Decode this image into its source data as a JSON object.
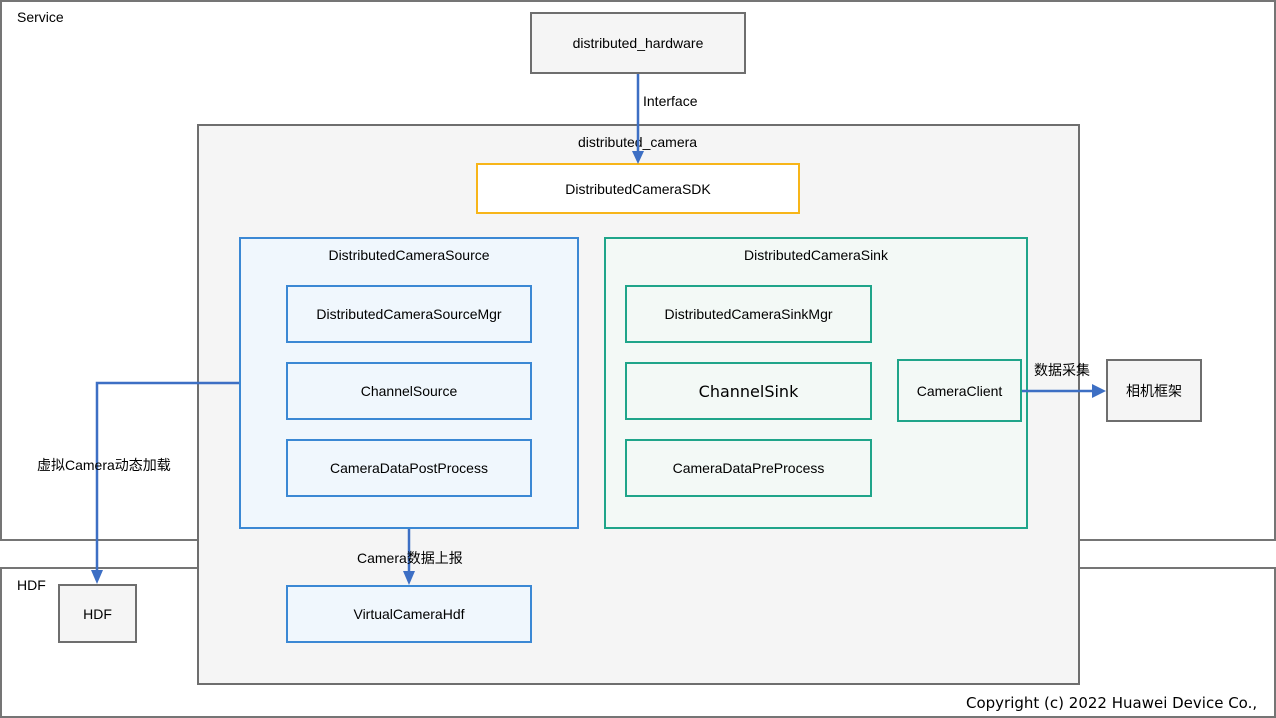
{
  "zones": {
    "service": {
      "label": "Service"
    },
    "hdf": {
      "label": "HDF"
    }
  },
  "nodes": {
    "distributed_hardware": "distributed_hardware",
    "distributed_camera": "distributed_camera",
    "sdk": "DistributedCameraSDK",
    "source": {
      "title": "DistributedCameraSource",
      "items": [
        "DistributedCameraSourceMgr",
        "ChannelSource",
        "CameraDataPostProcess"
      ]
    },
    "sink": {
      "title": "DistributedCameraSink",
      "items": [
        "DistributedCameraSinkMgr",
        "ChannelSink",
        "CameraDataPreProcess"
      ],
      "client": "CameraClient"
    },
    "camera_framework": "相机框架",
    "hdf": "HDF",
    "virtual_camera_hdf": "VirtualCameraHdf"
  },
  "edges": {
    "interface": "Interface",
    "data_collect": "数据采集",
    "virtual_camera_load": "虚拟Camera动态加载",
    "camera_data_report": "Camera数据上报"
  },
  "colors": {
    "arrow": "#3d6fc4",
    "source_border": "#3b88d4",
    "sink_border": "#1fa58a",
    "sdk_border": "#f7b519",
    "gray_border": "#6e6e6e"
  },
  "footer": {
    "copyright": "Copyright (c) 2022 Huawei Device Co.,"
  }
}
